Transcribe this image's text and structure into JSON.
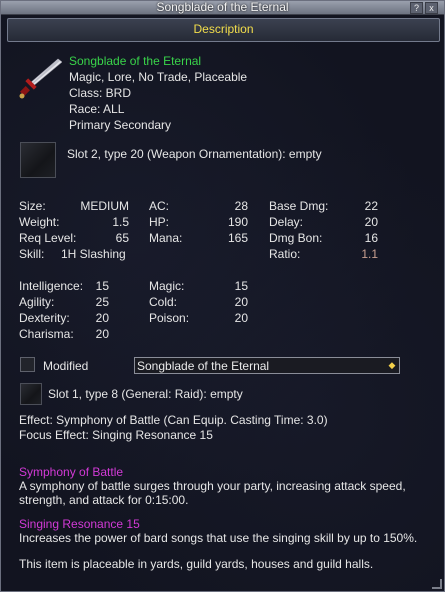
{
  "window": {
    "title": "Songblade of the Eternal",
    "help_glyph": "?",
    "close_glyph": "x"
  },
  "section": {
    "description_label": "Description"
  },
  "item": {
    "name": "Songblade of the Eternal",
    "flags": "Magic, Lore, No Trade, Placeable",
    "class": "Class: BRD",
    "race": "Race: ALL",
    "slots": "Primary Secondary",
    "ornament_slot": "Slot 2, type 20 (Weapon Ornamentation): empty"
  },
  "stats_a": {
    "size_label": "Size:",
    "size_value": "MEDIUM",
    "weight_label": "Weight:",
    "weight_value": "1.5",
    "req_label": "Req Level:",
    "req_value": "65",
    "skill_label": "Skill:",
    "skill_value": "1H Slashing",
    "ac_label": "AC:",
    "ac_value": "28",
    "hp_label": "HP:",
    "hp_value": "190",
    "mana_label": "Mana:",
    "mana_value": "165",
    "basedmg_label": "Base Dmg:",
    "basedmg_value": "22",
    "delay_label": "Delay:",
    "delay_value": "20",
    "dmgbon_label": "Dmg Bon:",
    "dmgbon_value": "16",
    "ratio_label": "Ratio:",
    "ratio_value": "1.1"
  },
  "stats_b": {
    "int_label": "Intelligence:",
    "int_value": "15",
    "agi_label": "Agility:",
    "agi_value": "25",
    "dex_label": "Dexterity:",
    "dex_value": "20",
    "cha_label": "Charisma:",
    "cha_value": "20",
    "magic_label": "Magic:",
    "magic_value": "15",
    "cold_label": "Cold:",
    "cold_value": "20",
    "poison_label": "Poison:",
    "poison_value": "20"
  },
  "modified": {
    "label": "Modified",
    "selected": "Songblade of the Eternal",
    "checked": false
  },
  "aug_slot": "Slot 1, type 8 (General: Raid): empty",
  "effects": {
    "effect": "Effect: Symphony of Battle (Can Equip. Casting Time: 3.0)",
    "focus": "Focus Effect: Singing Resonance 15"
  },
  "spells": [
    {
      "name": "Symphony of Battle",
      "desc": "A symphony of battle surges through your party, increasing attack speed, strength, and attack for 0:15:00."
    },
    {
      "name": "Singing Resonance 15",
      "desc": "Increases the power of bard songs that use the singing skill by up to 150%."
    }
  ],
  "footer_note": "This item is placeable in yards, guild yards, houses and guild halls.",
  "colors": {
    "green": "#39d34a",
    "magenta": "#d23ad6",
    "gold": "#f3de4b",
    "ratio": "#c9a090"
  }
}
